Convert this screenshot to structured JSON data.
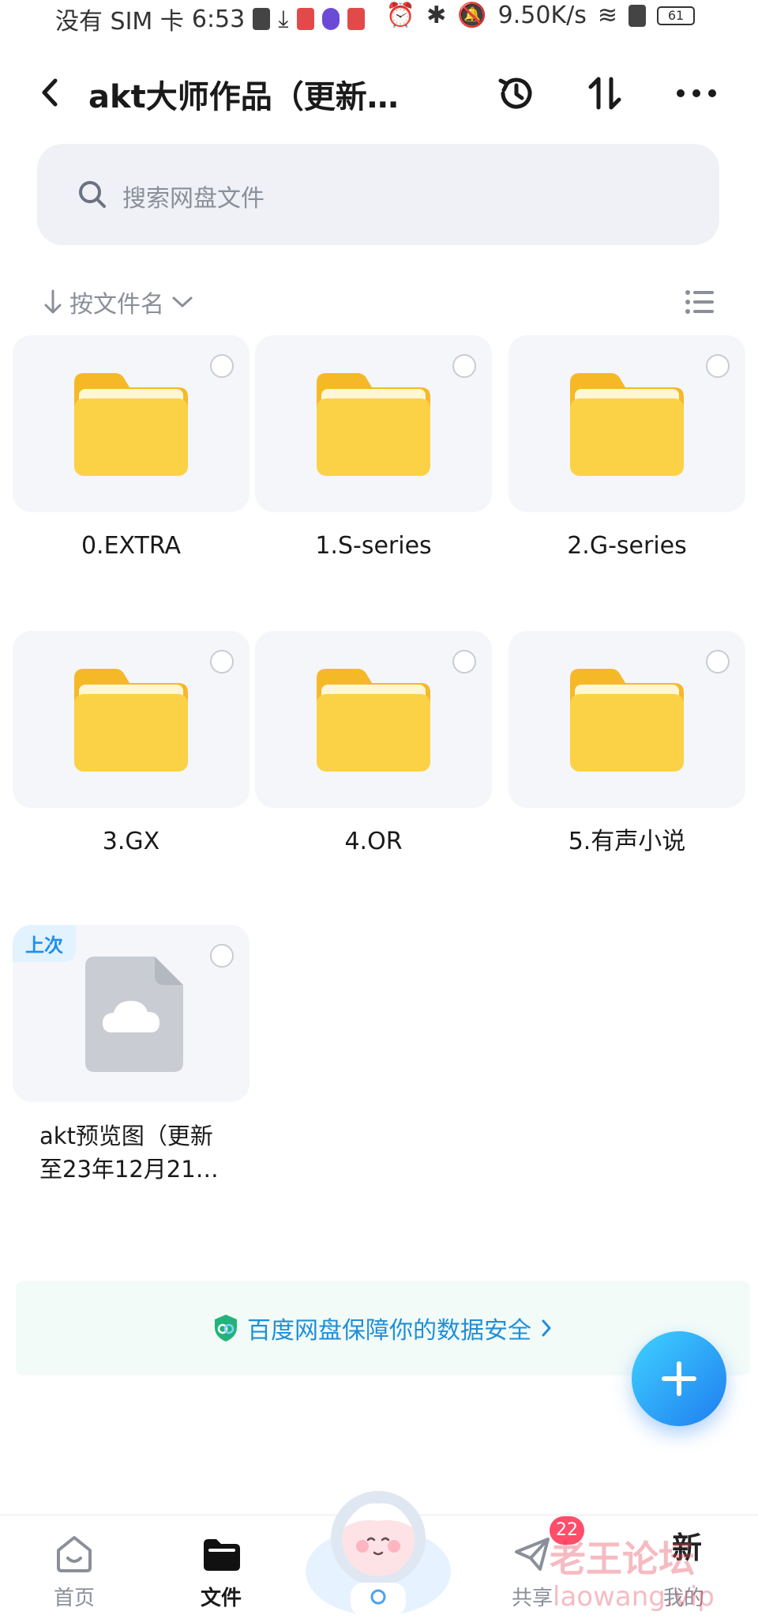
{
  "status_bar": {
    "carrier": "没有 SIM 卡",
    "time": "6:53",
    "speed": "9.50K/s",
    "battery": "61"
  },
  "header": {
    "title": "akt大师作品（更新…",
    "icons": [
      "back-icon",
      "history-icon",
      "sort-transfer-icon",
      "more-icon"
    ]
  },
  "search": {
    "placeholder": "搜索网盘文件"
  },
  "sort": {
    "label": "按文件名"
  },
  "files": [
    {
      "name": "0.EXTRA",
      "type": "folder"
    },
    {
      "name": "1.S-series",
      "type": "folder"
    },
    {
      "name": "2.G-series",
      "type": "folder"
    },
    {
      "name": "3.GX",
      "type": "folder"
    },
    {
      "name": "4.OR",
      "type": "folder"
    },
    {
      "name": "5.有声小说",
      "type": "folder"
    },
    {
      "name_line1": "akt预览图（更新",
      "name_line2": "至23年12月21…",
      "type": "file",
      "badge": "上次"
    }
  ],
  "promo": {
    "text": "百度网盘保障你的数据安全"
  },
  "tabs": [
    {
      "label": "首页",
      "icon": "home-icon"
    },
    {
      "label": "文件",
      "icon": "folder-icon",
      "active": true
    },
    {
      "label": "共享",
      "icon": "share-icon",
      "badge": "22"
    },
    {
      "label": "我的",
      "icon": "new-icon",
      "text": "新"
    }
  ],
  "watermark": {
    "line1": "老王论坛",
    "line2": "laowang.vip"
  },
  "colors": {
    "accent": "#1f7df0",
    "folder": "#fbd246",
    "promo_text": "#1f8fd8",
    "badge_red": "#ff4d6a"
  }
}
